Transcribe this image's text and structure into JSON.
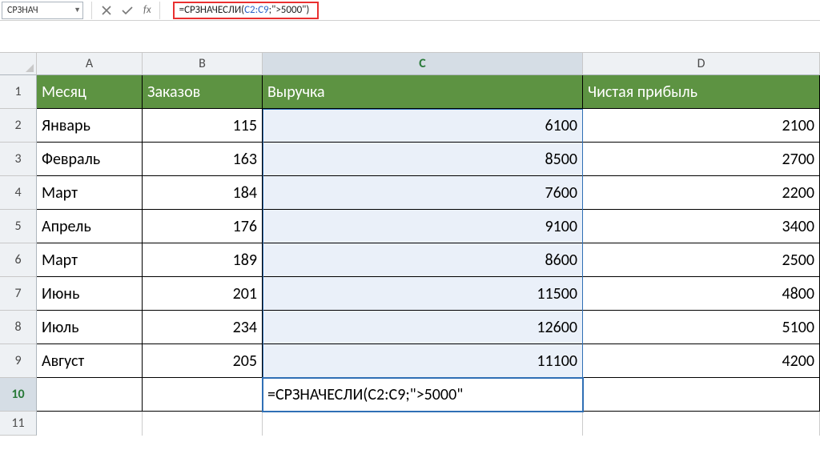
{
  "formula_bar": {
    "name_box_value": "СРЗНАЧ",
    "formula_prefix": "=СРЗНАЧЕСЛИ(",
    "formula_range": "C2:C9",
    "formula_suffix": ";\">5000\")",
    "fx_label": "fx"
  },
  "column_headers": [
    "A",
    "B",
    "C",
    "D"
  ],
  "row_headers": [
    "1",
    "2",
    "3",
    "4",
    "5",
    "6",
    "7",
    "8",
    "9",
    "10",
    "11"
  ],
  "header_row": {
    "A": "Месяц",
    "B": "Заказов",
    "C": "Выручка",
    "D": "Чистая прибыль"
  },
  "rows": [
    {
      "A": "Январь",
      "B": "115",
      "C": "6100",
      "D": "2100"
    },
    {
      "A": "Февраль",
      "B": "163",
      "C": "8500",
      "D": "2700"
    },
    {
      "A": "Март",
      "B": "184",
      "C": "7600",
      "D": "2200"
    },
    {
      "A": "Апрель",
      "B": "176",
      "C": "9100",
      "D": "3400"
    },
    {
      "A": "Март",
      "B": "189",
      "C": "8600",
      "D": "2500"
    },
    {
      "A": "Июнь",
      "B": "201",
      "C": "11500",
      "D": "4800"
    },
    {
      "A": "Июль",
      "B": "234",
      "C": "12600",
      "D": "5100"
    },
    {
      "A": "Август",
      "B": "205",
      "C": "11100",
      "D": "4200"
    }
  ],
  "active_cell_formula": "=СРЗНАЧЕСЛИ(C2:C9;\">5000\""
}
